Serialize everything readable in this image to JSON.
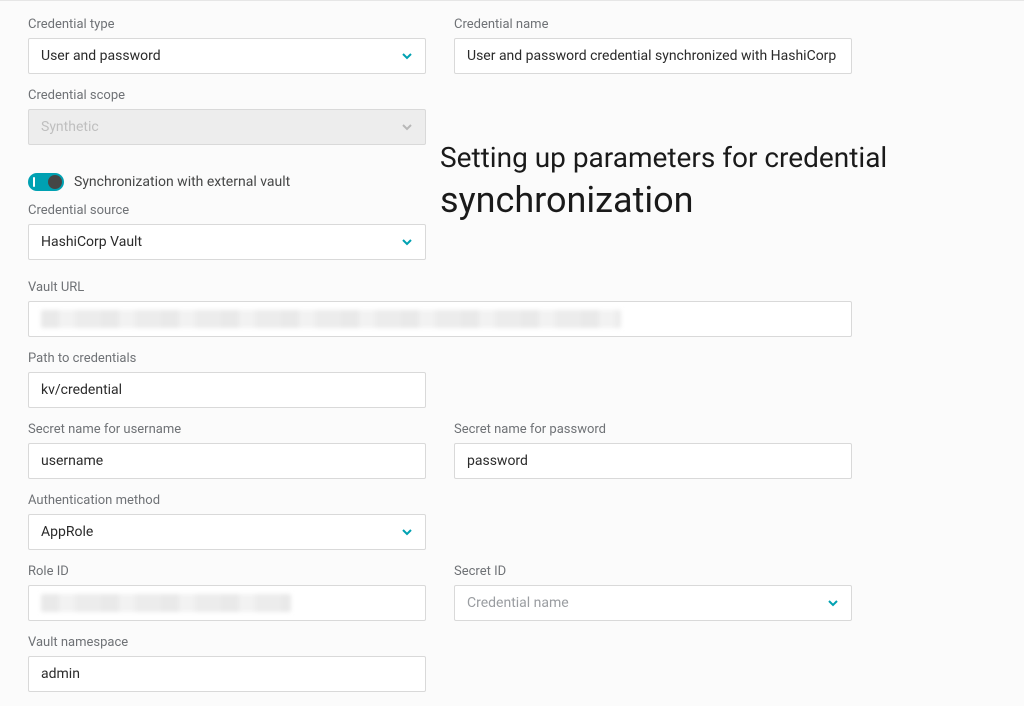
{
  "heading": {
    "line1": "Setting up parameters for credential",
    "line2": "synchronization"
  },
  "fields": {
    "credential_type": {
      "label": "Credential type",
      "value": "User and password"
    },
    "credential_name": {
      "label": "Credential name",
      "value": "User and password credential synchronized with HashiCorp"
    },
    "credential_scope": {
      "label": "Credential scope",
      "value": "Synthetic"
    },
    "sync_toggle": {
      "label": "Synchronization with external vault",
      "on": true
    },
    "credential_source": {
      "label": "Credential source",
      "value": "HashiCorp Vault"
    },
    "vault_url": {
      "label": "Vault URL",
      "value": ""
    },
    "path_to_credentials": {
      "label": "Path to credentials",
      "value": "kv/credential"
    },
    "secret_username": {
      "label": "Secret name for username",
      "value": "username"
    },
    "secret_password": {
      "label": "Secret name for password",
      "value": "password"
    },
    "auth_method": {
      "label": "Authentication method",
      "value": "AppRole"
    },
    "role_id": {
      "label": "Role ID",
      "value": ""
    },
    "secret_id": {
      "label": "Secret ID",
      "placeholder": "Credential name",
      "value": ""
    },
    "vault_namespace": {
      "label": "Vault namespace",
      "value": "admin"
    }
  },
  "colors": {
    "accent": "#00a1b2",
    "chevron": "#00a1b2",
    "chevron_muted": "#b8b8b8"
  }
}
